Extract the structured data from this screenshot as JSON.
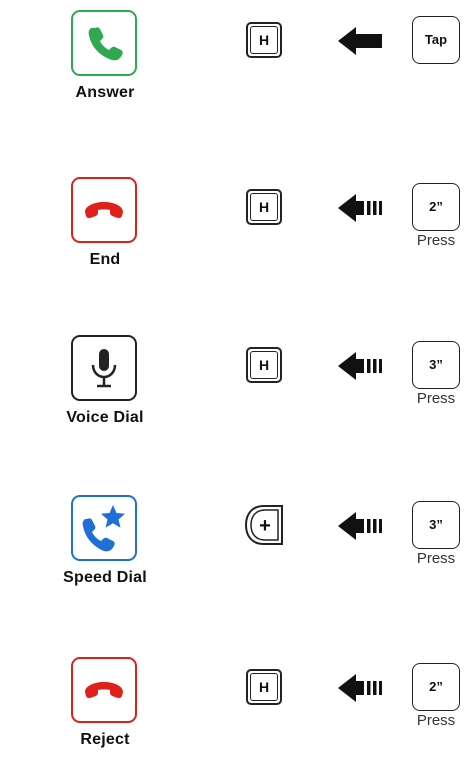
{
  "rows": [
    {
      "function": "Answer",
      "icon": "phone-icon",
      "icon_color": "#2fa84f",
      "button": "H",
      "arrow": "solid-arrow-left-icon",
      "action": "Tap",
      "duration_label": ""
    },
    {
      "function": "End",
      "icon": "hang-up-icon",
      "icon_color": "#e0201b",
      "button": "H",
      "arrow": "hold-arrow-left-icon",
      "action": "2”",
      "duration_label": "Press"
    },
    {
      "function": "Voice Dial",
      "icon": "microphone-icon",
      "icon_color": "#222222",
      "button": "H",
      "arrow": "hold-arrow-left-icon",
      "action": "3”",
      "duration_label": "Press"
    },
    {
      "function": "Speed Dial",
      "icon": "speed-dial-icon",
      "icon_color": "#1f6fd6",
      "button": "+",
      "arrow": "hold-arrow-left-icon",
      "action": "3”",
      "duration_label": "Press"
    },
    {
      "function": "Reject",
      "icon": "hang-up-icon",
      "icon_color": "#e0201b",
      "button": "H",
      "arrow": "hold-arrow-left-icon",
      "action": "2”",
      "duration_label": "Press"
    }
  ]
}
